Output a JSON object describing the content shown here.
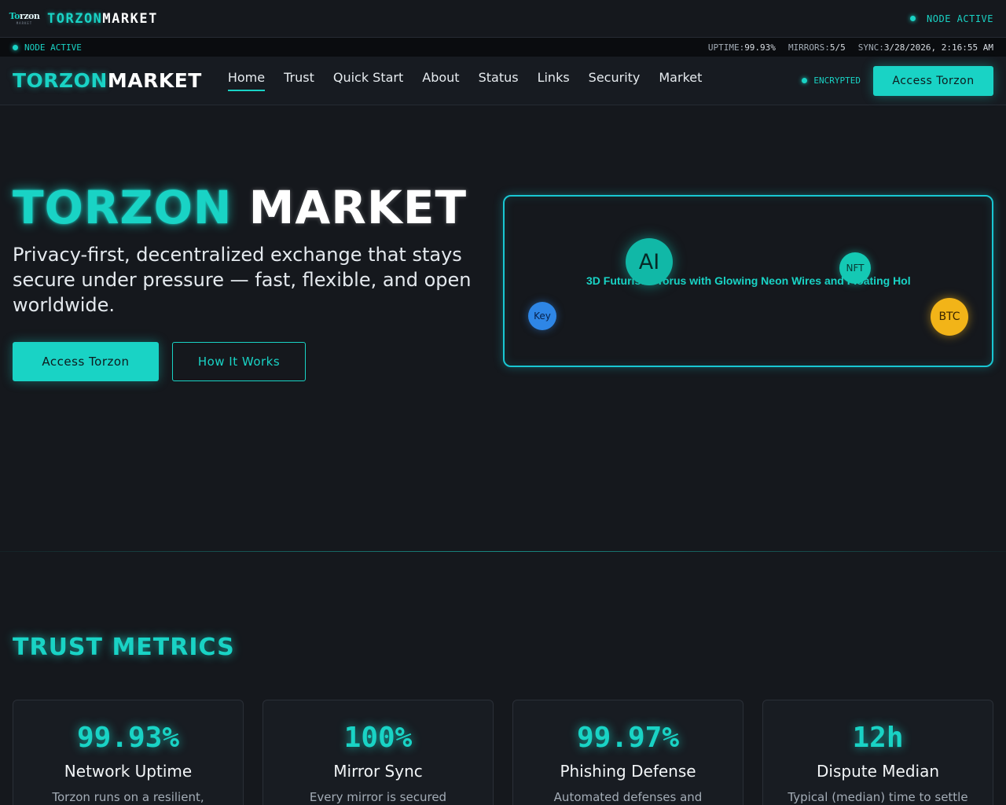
{
  "appbar": {
    "logo_top_a": "To",
    "logo_top_b": "rzon",
    "logo_sub": "MARKET",
    "brand_a": "TORZON",
    "brand_b": "MARKET",
    "status": "NODE ACTIVE"
  },
  "ticker": {
    "status": "NODE ACTIVE",
    "uptime_label": "UPTIME:",
    "uptime": "99.93%",
    "mirrors_label": "MIRRORS:",
    "mirrors": "5/5",
    "sync_label": "SYNC:",
    "sync": "3/28/2026, 2:16:55 AM"
  },
  "nav": {
    "brand_a": "TORZON",
    "brand_b": "MARKET",
    "links": [
      "Home",
      "Trust",
      "Quick Start",
      "About",
      "Status",
      "Links",
      "Security",
      "Market"
    ],
    "encrypted": "ENCRYPTED",
    "cta": "Access Torzon"
  },
  "hero": {
    "title_a": "TORZON",
    "title_b": "MARKET",
    "subtitle": "Privacy-first, decentralized exchange that stays secure under pressure — fast, flexible, and open worldwide.",
    "primary": "Access Torzon",
    "secondary": "How It Works",
    "image_alt": "3D Futuristic Torus with Glowing Neon Wires and Floating Hol",
    "orbs": {
      "ai": "AI",
      "nft": "NFT",
      "key": "Key",
      "btc": "BTC"
    }
  },
  "trust": {
    "title": "TRUST METRICS",
    "cards": [
      {
        "value": "99.93%",
        "label": "Network Uptime",
        "desc": "Torzon runs on a resilient,"
      },
      {
        "value": "100%",
        "label": "Mirror Sync",
        "desc": "Every mirror is secured"
      },
      {
        "value": "99.97%",
        "label": "Phishing Defense",
        "desc": "Automated defenses and"
      },
      {
        "value": "12h",
        "label": "Dispute Median",
        "desc": "Typical (median) time to settle"
      }
    ]
  },
  "colors": {
    "accent": "#19d3c5",
    "background": "#15181d",
    "btc": "#f2b418",
    "key": "#2e86e6"
  }
}
